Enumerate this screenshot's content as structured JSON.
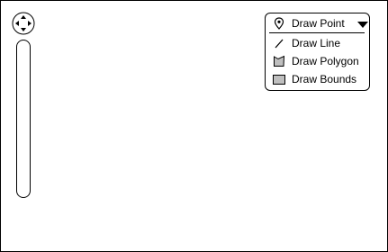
{
  "map": {
    "controls": {
      "pan": {
        "icon": "pan-arrows-icon"
      },
      "zoom": {
        "icon": "zoom-slider"
      }
    }
  },
  "draw_menu": {
    "selected": "Draw Point",
    "items": [
      {
        "label": "Draw Point",
        "icon": "map-pin-icon"
      },
      {
        "label": "Draw Line",
        "icon": "line-icon"
      },
      {
        "label": "Draw Polygon",
        "icon": "polygon-icon"
      },
      {
        "label": "Draw Bounds",
        "icon": "rectangle-icon"
      }
    ],
    "caret_icon": "caret-down-icon"
  }
}
